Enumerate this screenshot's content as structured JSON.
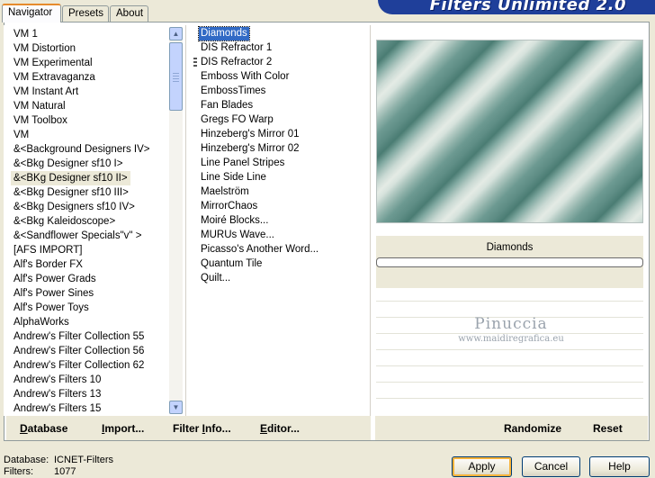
{
  "tabs": [
    "Navigator",
    "Presets",
    "About"
  ],
  "banner_title": "Filters Unlimited 2.0",
  "categories": [
    "VM 1",
    "VM Distortion",
    "VM Experimental",
    "VM Extravaganza",
    "VM Instant Art",
    "VM Natural",
    "VM Toolbox",
    "VM",
    "&<Background Designers IV>",
    "&<Bkg Designer sf10 I>",
    "&<BKg Designer sf10 II>",
    "&<Bkg Designer sf10 III>",
    "&<Bkg Designers sf10 IV>",
    "&<Bkg Kaleidoscope>",
    "&<Sandflower Specials\"v\" >",
    "[AFS IMPORT]",
    "Alf's Border FX",
    "Alf's Power Grads",
    "Alf's Power Sines",
    "Alf's Power Toys",
    "AlphaWorks",
    "Andrew's Filter Collection 55",
    "Andrew's Filter Collection 56",
    "Andrew's Filter Collection 62",
    "Andrew's Filters 10",
    "Andrew's Filters 13",
    "Andrew's Filters 15"
  ],
  "selected_category_index": 10,
  "filters": [
    "Diamonds",
    "DIS Refractor 1",
    "DIS Refractor 2",
    "Emboss With Color",
    "EmbossTimes",
    "Fan Blades",
    "Gregs FO Warp",
    "Hinzeberg's Mirror 01",
    "Hinzeberg's Mirror 02",
    "Line Panel Stripes",
    "Line Side Line",
    "Maelström",
    "MirrorChaos",
    "Moiré Blocks...",
    "MURUs Wave...",
    "Picasso's Another Word...",
    "Quantum Tile",
    "Quilt..."
  ],
  "selected_filter_index": 0,
  "marked_filter_index": 2,
  "preview": {
    "filter_name": "Diamonds"
  },
  "watermark": {
    "name": "Pinuccia",
    "url": "www.maidiregrafica.eu"
  },
  "toolbar_left": {
    "database": {
      "accel": "D",
      "rest": "atabase"
    },
    "import": {
      "accel": "I",
      "rest": "mport..."
    },
    "filter_info": {
      "pre": "Filter ",
      "accel": "I",
      "rest": "nfo..."
    },
    "editor": {
      "accel": "E",
      "rest": "ditor..."
    }
  },
  "toolbar_right": {
    "randomize": "Randomize",
    "reset": "Reset"
  },
  "status": {
    "database_label": "Database:",
    "database_value": "ICNET-Filters",
    "filters_label": "Filters:",
    "filters_value": "1077"
  },
  "buttons": {
    "apply": "Apply",
    "cancel": "Cancel",
    "help": "Help"
  },
  "colors": {
    "selection": "#316ac5",
    "banner": "#1f3f9a",
    "dialog": "#ece9d8"
  }
}
